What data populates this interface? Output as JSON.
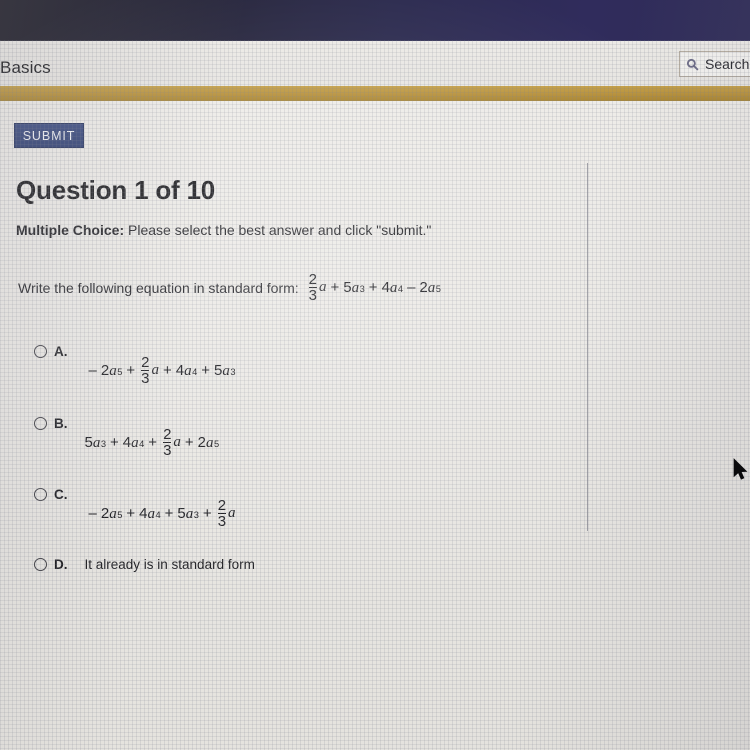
{
  "nav": {
    "course_label": "Basics",
    "search": {
      "label": "Search",
      "icon": "search-icon"
    }
  },
  "colors": {
    "top_band": "#2b2a4e",
    "gold_bar": "#b8913a",
    "submit_button": "#2f3f72",
    "page_background": "#eae8e4",
    "text": "#1c1c20"
  },
  "toolbar": {
    "submit_label": "SUBMIT"
  },
  "question": {
    "title": "Question 1 of 10",
    "number": 1,
    "total": 10,
    "type_label": "Multiple Choice:",
    "instructions": " Please select the best answer and click \"submit.\"",
    "prompt_text": "Write the following equation in standard form:",
    "prompt_expression": "2/3 a + 5a^3 + 4a^4 - 2a^5",
    "expression_terms": [
      {
        "coef_num": "2",
        "coef_den": "3",
        "var": "a",
        "exp": "",
        "sign": ""
      },
      {
        "coef": "5",
        "var": "a",
        "exp": "3",
        "sign": "+"
      },
      {
        "coef": "4",
        "var": "a",
        "exp": "4",
        "sign": "+"
      },
      {
        "coef": "2",
        "var": "a",
        "exp": "5",
        "sign": "–"
      }
    ]
  },
  "options": [
    {
      "letter": "A.",
      "kind": "math",
      "expression": "-2a^5 + 2/3 a + 4a^4 + 5a^3",
      "selected": false
    },
    {
      "letter": "B.",
      "kind": "math",
      "expression": "5a^3 + 4a^4 + 2/3 a + 2a^5",
      "selected": false
    },
    {
      "letter": "C.",
      "kind": "math",
      "expression": "-2a^5 + 4a^4 + 5a^3 + 2/3 a",
      "selected": false
    },
    {
      "letter": "D.",
      "kind": "text",
      "text": "It already is in standard form",
      "selected": false
    }
  ],
  "math_glyphs": {
    "minus": "–",
    "plus": "+",
    "var": "a",
    "frac_num": "2",
    "frac_den": "3"
  }
}
